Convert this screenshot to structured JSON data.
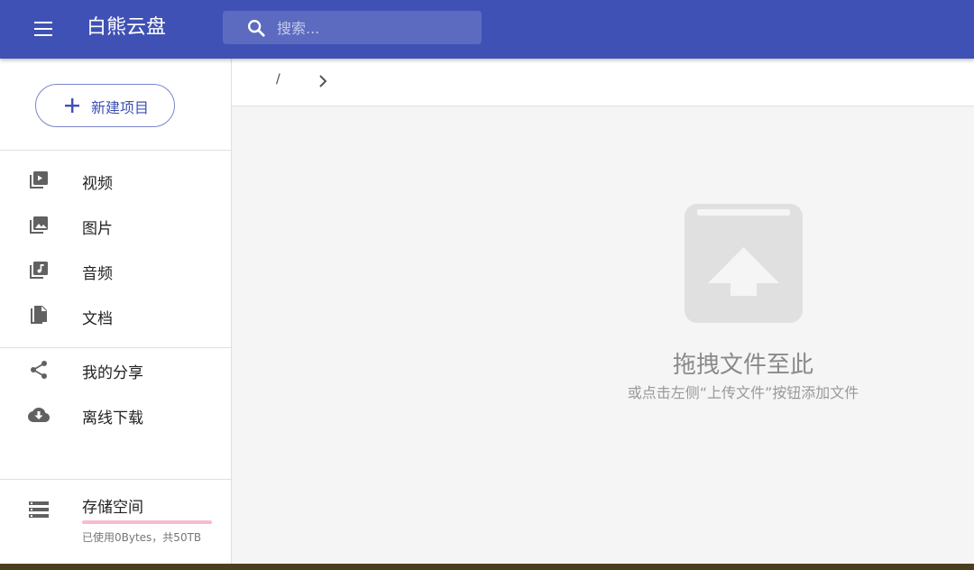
{
  "app": {
    "title": "白熊云盘",
    "accent_color": "#3f51b5",
    "search_placeholder": "搜索...",
    "menu_icon": "menu-icon",
    "search_icon": "search-icon"
  },
  "sidebar": {
    "new_button": {
      "label": "新建项目",
      "icon": "plus-icon"
    },
    "items": [
      {
        "label": "视频",
        "icon": "video-library-icon"
      },
      {
        "label": "图片",
        "icon": "photo-library-icon"
      },
      {
        "label": "音频",
        "icon": "music-library-icon"
      },
      {
        "label": "文档",
        "icon": "file-copy-icon"
      },
      {
        "label": "我的分享",
        "icon": "share-icon"
      },
      {
        "label": "离线下载",
        "icon": "cloud-download-icon"
      }
    ],
    "storage": {
      "label": "存储空间",
      "info": "已使用0Bytes，共50TB",
      "used_fraction": 0.0,
      "bar_color": "#ff4081",
      "icon": "storage-icon"
    }
  },
  "breadcrumb": {
    "root": "/",
    "separator_icon": "chevron-right-icon"
  },
  "empty_state": {
    "title": "拖拽文件至此",
    "subtitle": "或点击左侧“上传文件”按钮添加文件",
    "icon": "upload-box-icon"
  }
}
